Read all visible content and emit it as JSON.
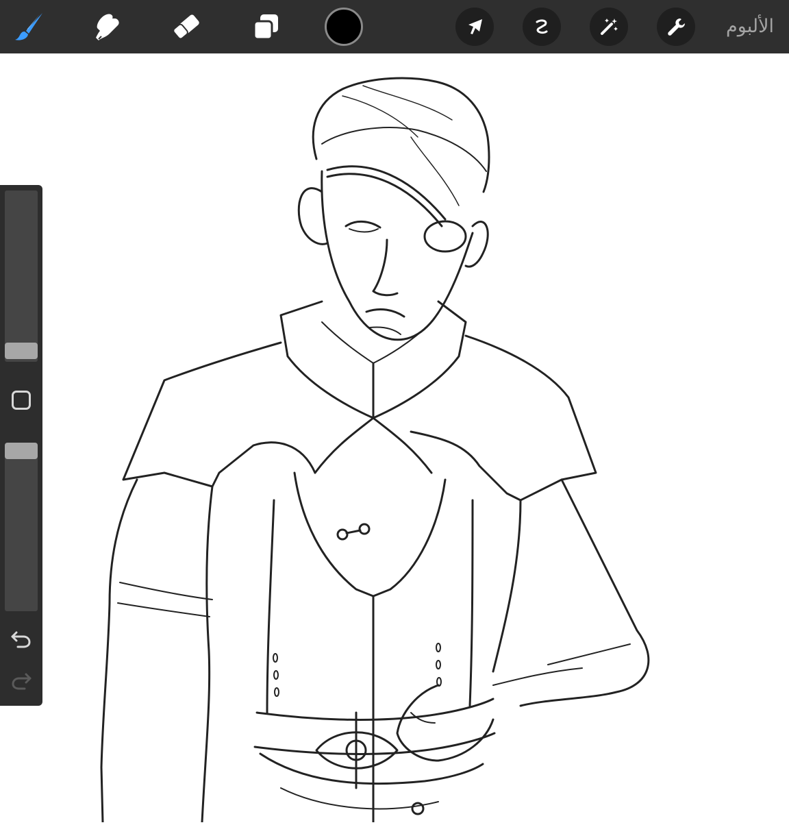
{
  "toolbar": {
    "gallery_label": "الألبوم",
    "tools": [
      {
        "name": "brush-icon",
        "active": true,
        "color": "#3b9cff"
      },
      {
        "name": "smudge-icon",
        "active": false
      },
      {
        "name": "eraser-icon",
        "active": false
      },
      {
        "name": "layers-icon",
        "active": false
      }
    ],
    "current_color": "#000000",
    "actions": [
      "transform-arrow-icon",
      "selection-s-icon",
      "adjustments-wand-icon",
      "wrench-icon"
    ]
  },
  "sidebar": {
    "brush_size_level": 0.97,
    "opacity_level": 0.92,
    "modify_button_icon": "square-icon",
    "undo_icon": "undo-arrow-icon",
    "redo_icon": "redo-arrow-icon"
  },
  "canvas": {
    "content": "sketch-drawing"
  }
}
